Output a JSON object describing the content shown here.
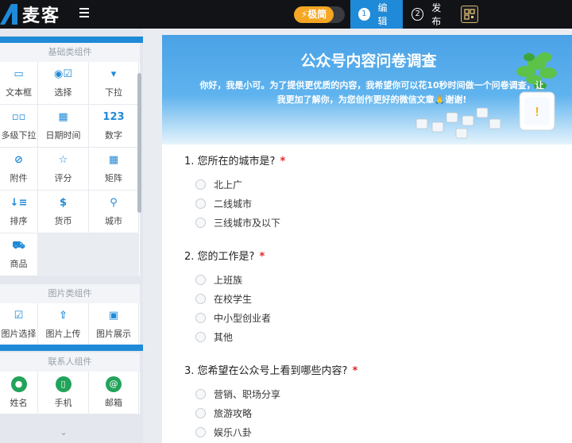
{
  "app": {
    "name": "麦客",
    "speed_mode": "⚡极简",
    "steps": [
      {
        "num": "1",
        "label": "编辑"
      },
      {
        "num": "2",
        "label": "发布"
      }
    ]
  },
  "colors": {
    "accent": "#1f8ad8",
    "required": "#e0262b",
    "orange": "#f5a623"
  },
  "sidebar": {
    "basic": {
      "title": "基础类组件",
      "items": [
        {
          "icon": "▭",
          "icon_name": "textbox-icon",
          "label": "文本框"
        },
        {
          "icon": "◉☑",
          "icon_name": "choice-icon",
          "label": "选择"
        },
        {
          "icon": "▾",
          "icon_name": "dropdown-icon",
          "label": "下拉"
        },
        {
          "icon": "▫▫",
          "icon_name": "cascade-icon",
          "label": "多级下拉"
        },
        {
          "icon": "▦",
          "icon_name": "calendar-icon",
          "label": "日期时间"
        },
        {
          "icon": "123",
          "icon_name": "number-icon",
          "label": "数字"
        },
        {
          "icon": "⊘",
          "icon_name": "attachment-icon",
          "label": "附件"
        },
        {
          "icon": "☆",
          "icon_name": "star-icon",
          "label": "评分"
        },
        {
          "icon": "▦",
          "icon_name": "matrix-icon",
          "label": "矩阵"
        },
        {
          "icon": "↓≡",
          "icon_name": "sort-icon",
          "label": "排序"
        },
        {
          "icon": "$",
          "icon_name": "currency-icon",
          "label": "货币"
        },
        {
          "icon": "⚲",
          "icon_name": "location-icon",
          "label": "城市"
        },
        {
          "icon": "⛟",
          "icon_name": "cart-icon",
          "label": "商品"
        }
      ]
    },
    "image": {
      "title": "图片类组件",
      "items": [
        {
          "icon": "☑",
          "icon_name": "image-select-icon",
          "label": "图片选择"
        },
        {
          "icon": "⇧",
          "icon_name": "image-upload-icon",
          "label": "图片上传"
        },
        {
          "icon": "▣",
          "icon_name": "image-display-icon",
          "label": "图片展示"
        }
      ]
    },
    "contact": {
      "title": "联系人组件",
      "items": [
        {
          "icon": "●",
          "icon_name": "person-icon",
          "label": "姓名"
        },
        {
          "icon": "▯",
          "icon_name": "phone-icon",
          "label": "手机"
        },
        {
          "icon": "@",
          "icon_name": "email-icon",
          "label": "邮箱"
        }
      ]
    }
  },
  "survey": {
    "title": "公众号内容问卷调查",
    "description_line1": "你好，我是小可。为了提供更优质的内容，我希望你可以花10秒时间做一个问卷调查，让",
    "description_line2": "我更加了解你，为您创作更好的微信文章🙏谢谢!",
    "questions": [
      {
        "title": "1. 您所在的城市是?",
        "required_mark": "*",
        "options": [
          "北上广",
          "二线城市",
          "三线城市及以下"
        ]
      },
      {
        "title": "2. 您的工作是?",
        "required_mark": "*",
        "options": [
          "上班族",
          "在校学生",
          "中小型创业者",
          "其他"
        ]
      },
      {
        "title": "3. 您希望在公众号上看到哪些内容?",
        "required_mark": "*",
        "options": [
          "营销、职场分享",
          "旅游攻略",
          "娱乐八卦"
        ]
      }
    ]
  }
}
